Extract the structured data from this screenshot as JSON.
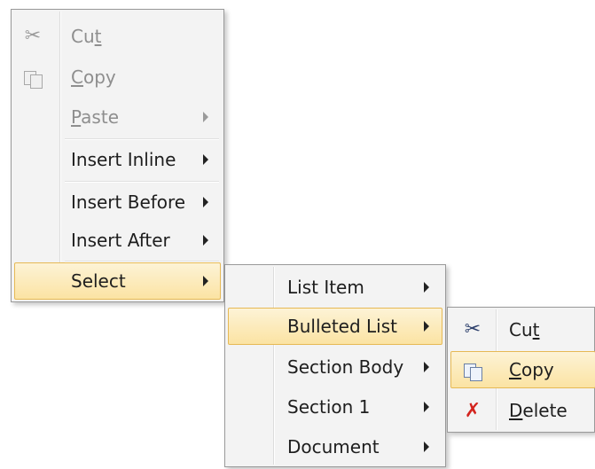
{
  "menu1": {
    "items": [
      {
        "label": "Cut",
        "underline": "t",
        "icon": "scissors-icon",
        "disabled": true
      },
      {
        "label": "Copy",
        "underline": "C",
        "icon": "copy-icon",
        "disabled": true
      },
      {
        "label": "Paste",
        "underline": "P",
        "disabled": true,
        "submenu": true
      },
      {
        "label": "Insert Inline",
        "submenu": true
      },
      {
        "label": "Insert Before",
        "submenu": true
      },
      {
        "label": "Insert After",
        "submenu": true
      },
      {
        "label": "Select",
        "submenu": true,
        "highlighted": true
      }
    ]
  },
  "menu2": {
    "items": [
      {
        "label": "List Item",
        "submenu": true
      },
      {
        "label": "Bulleted List",
        "submenu": true,
        "highlighted": true
      },
      {
        "label": "Section Body",
        "submenu": true
      },
      {
        "label": "Section 1",
        "submenu": true
      },
      {
        "label": "Document",
        "submenu": true
      }
    ]
  },
  "menu3": {
    "items": [
      {
        "label": "Cut",
        "icon": "scissors-icon"
      },
      {
        "label": "Copy",
        "icon": "copy-icon",
        "highlighted": true
      },
      {
        "label": "Delete",
        "icon": "delete-icon"
      }
    ]
  },
  "colors": {
    "menu_bg": "#f3f3f3",
    "highlight_top": "#fdf3d6",
    "highlight_bottom": "#fbe3a3",
    "highlight_border": "#e6b955",
    "disabled_text": "#8e8e8e",
    "delete_icon": "#d3241e"
  }
}
